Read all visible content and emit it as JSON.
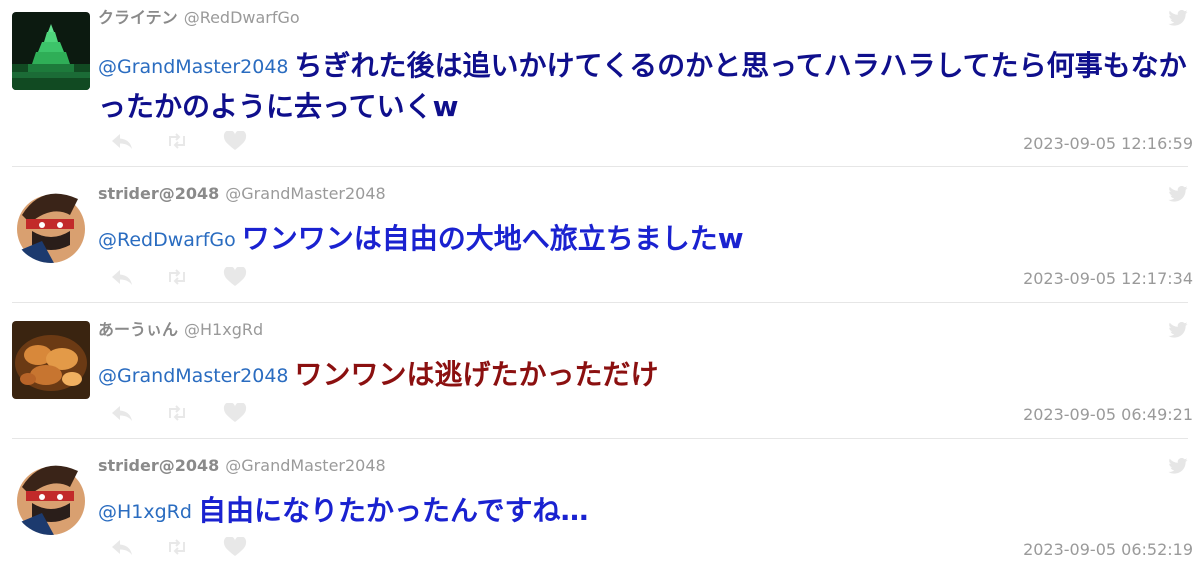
{
  "tweets": [
    {
      "name": "クライテン",
      "handle": "@RedDwarfGo",
      "mention": "@GrandMaster2048",
      "text": "ちぎれた後は追いかけてくるのかと思ってハラハラしてたら何事もなかったかのように去っていくw",
      "text_color": "#0f0f8c",
      "time": "2023-09-05 12:16:59",
      "avatar_icon": "castle-avatar"
    },
    {
      "name": "strider@2048",
      "handle": "@GrandMaster2048",
      "mention": "@RedDwarfGo",
      "text": "ワンワンは自由の大地へ旅立ちましたw",
      "text_color": "#1a22d0",
      "time": "2023-09-05 12:17:34",
      "avatar_icon": "ninja-avatar"
    },
    {
      "name": "あーうぃん",
      "handle": "@H1xgRd",
      "mention": "@GrandMaster2048",
      "text": "ワンワンは逃げたかっただけ",
      "text_color": "#8b1010",
      "time": "2023-09-05 06:49:21",
      "avatar_icon": "food-avatar"
    },
    {
      "name": "strider@2048",
      "handle": "@GrandMaster2048",
      "mention": "@H1xgRd",
      "text": "自由になりたかったんですね…",
      "text_color": "#1a22d0",
      "time": "2023-09-05 06:52:19",
      "avatar_icon": "ninja-avatar"
    }
  ],
  "icons": {
    "reply": "reply-icon",
    "retweet": "retweet-icon",
    "like": "heart-icon",
    "brand": "twitter-bird-icon"
  }
}
